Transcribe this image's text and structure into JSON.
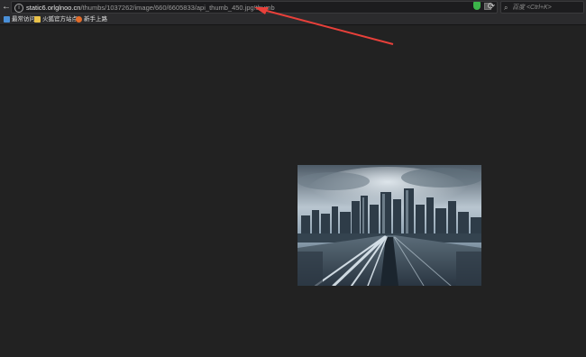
{
  "browser": {
    "url_host": "static6.orlglnoo.cn",
    "url_path": "/thumbs/1037262/image/660/6605833/api_thumb_450.jpg!thumb",
    "search_placeholder": "百度 <Ctrl+K>",
    "back_icon": "back-arrow-icon",
    "reload_icon": "reload-icon"
  },
  "bookmarks": [
    {
      "label": "最常访问",
      "icon": "bookmark-folder-icon"
    },
    {
      "label": "火狐官方站点",
      "icon": "bookmark-folder-icon"
    },
    {
      "label": "新手上路",
      "icon": "firefox-icon"
    }
  ],
  "image": {
    "description_icon": "city-highway-image"
  },
  "colors": {
    "page_background": "#222222",
    "chrome_background": "#2b2b2d",
    "annotation_arrow": "#e8403a"
  }
}
